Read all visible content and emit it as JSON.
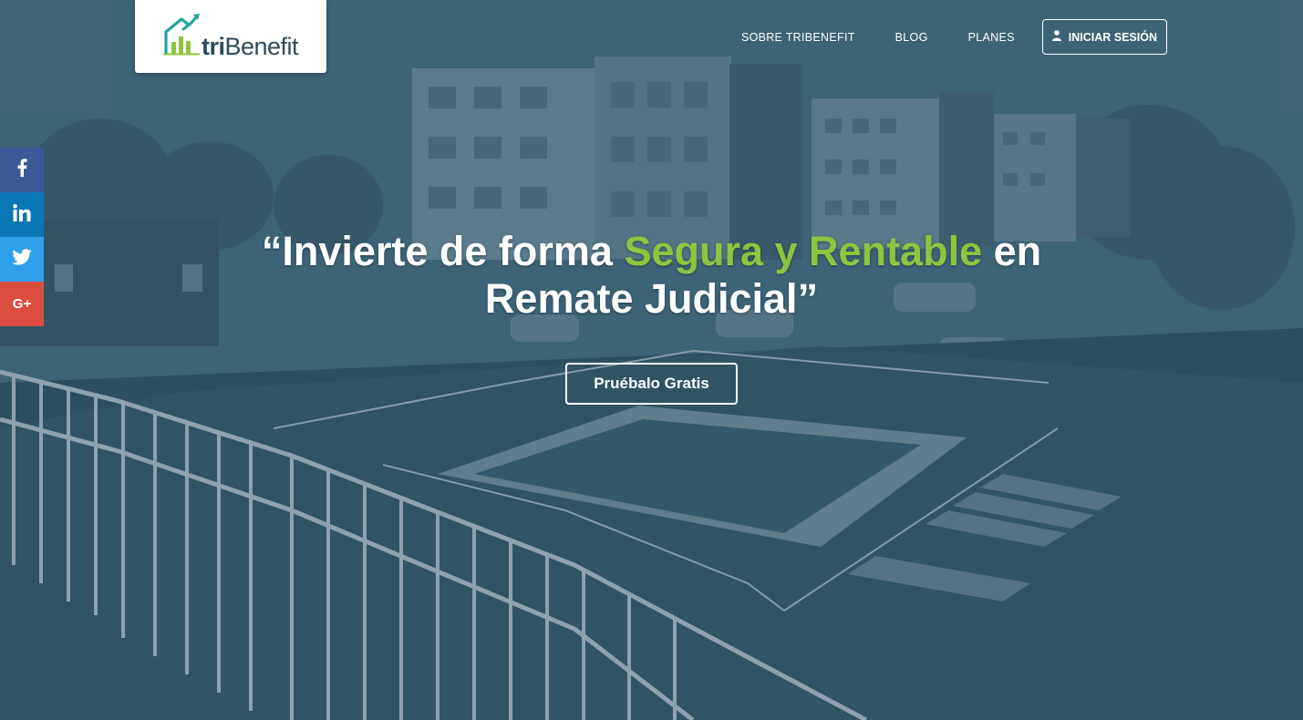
{
  "brand": {
    "logo_text_bold": "tri",
    "logo_text_regular": "Benefit",
    "logo_icon": "house-chart-icon",
    "colors": {
      "green": "#8cc63f",
      "dark": "#2c4a5c",
      "teal": "#1fa3a0"
    }
  },
  "nav": {
    "items": [
      {
        "label": "SOBRE TRIBENEFIT"
      },
      {
        "label": "BLOG"
      },
      {
        "label": "PLANES"
      }
    ],
    "login_label": "INICIAR SESIÓN",
    "login_icon": "user-icon"
  },
  "share": {
    "items": [
      {
        "network": "facebook",
        "icon": "facebook-icon",
        "glyph": "f",
        "color": "#3b5998"
      },
      {
        "network": "linkedin",
        "icon": "linkedin-icon",
        "glyph": "in",
        "color": "#0a77b5"
      },
      {
        "network": "twitter",
        "icon": "twitter-icon",
        "glyph": "twitter",
        "color": "#2da0e8"
      },
      {
        "network": "googleplus",
        "icon": "google-plus-icon",
        "glyph": "G+",
        "color": "#dc4e41"
      }
    ]
  },
  "hero": {
    "headline_part1": "“Invierte de forma ",
    "headline_accent": "Segura y Rentable",
    "headline_part2": " en",
    "headline_line2": "Remate Judicial”",
    "accent_color": "#8cc63f",
    "cta_label": "Pruébalo Gratis"
  }
}
